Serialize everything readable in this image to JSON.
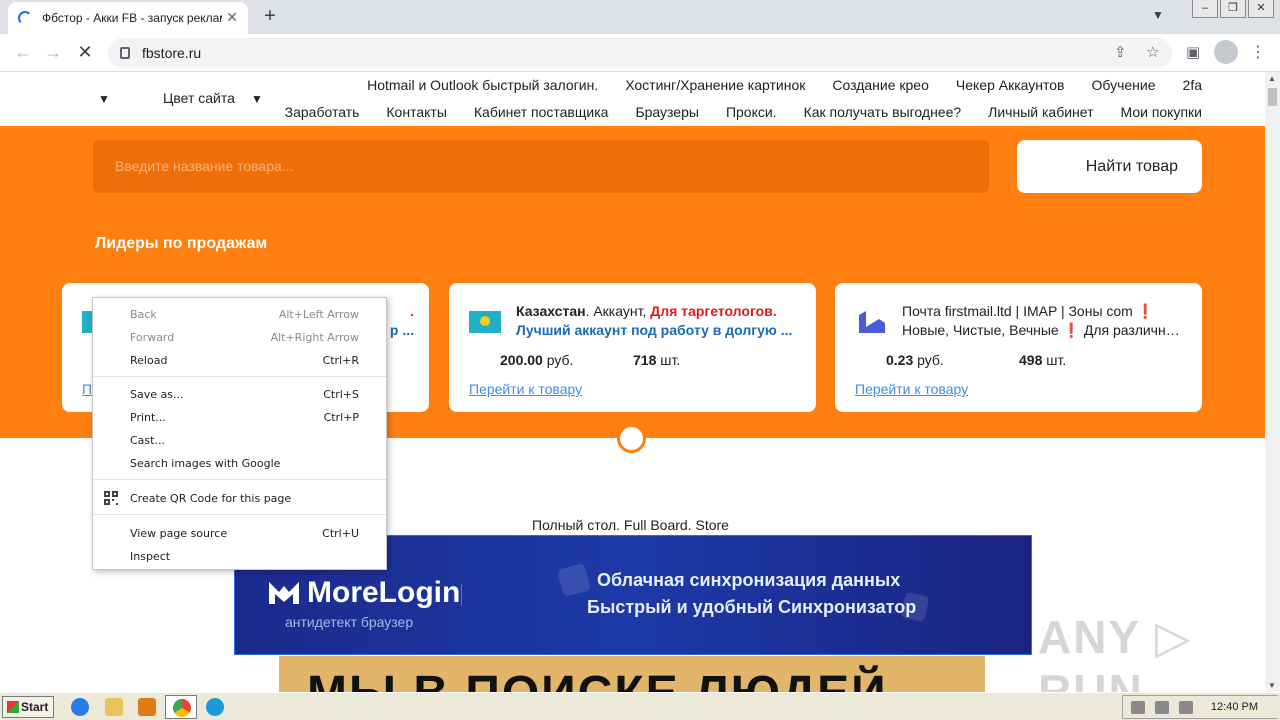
{
  "browser": {
    "tab_title": "Фбстор - Акки FB - запуск реклам",
    "url": "fbstore.ru",
    "window_buttons": [
      "–",
      "❐",
      "✕"
    ]
  },
  "header": {
    "site_color_label": "Цвет сайта",
    "nav_row1": [
      "Hotmail и Outlook быстрый залогин.",
      "Хостинг/Хранение картинок",
      "Создание крео",
      "Чекер Аккаунтов",
      "Обучение",
      "2fa"
    ],
    "nav_row2": [
      "Заработать",
      "Контакты",
      "Кабинет поставщика",
      "Браузеры",
      "Прокси.",
      "Как получать выгоднее?",
      "Личный кабинет",
      "Мои покупки"
    ]
  },
  "search": {
    "placeholder": "Введите название товара...",
    "button_label": "Найти товар"
  },
  "leaders_title": "Лидеры по продажам",
  "cards": [
    {
      "l1_partial": ".",
      "l2_partial": "р ...",
      "link_partial": "П"
    },
    {
      "title_bold": "Казахстан",
      "title_rest": ". Аккаунт, ",
      "title_red": "Для таргетологов.",
      "subtitle": "Лучший аккаунт под работу в долгую ...",
      "price": "200.00",
      "currency": "руб.",
      "stock": "718",
      "stock_unit": "шт.",
      "link": "Перейти к товару"
    },
    {
      "title": "Почта firstmail.ltd | IMAP | Зоны com ❗",
      "subtitle": "Новые, Чистые, Вечные ❗ Для различны...",
      "price": "0.23",
      "currency": "руб.",
      "stock": "498",
      "stock_unit": "шт.",
      "link": "Перейти к товару"
    }
  ],
  "board_label": "Полный стол. Full Board. Store",
  "banner": {
    "brand": "MoreLogin",
    "sub": "антидетект браузер",
    "line1": "Облачная синхронизация данных",
    "line2": "Быстрый и удобный Синхронизатор"
  },
  "banner2_text": "МЫ В ПОИСКЕ ЛЮДЕЙ",
  "watermark": "ANY ▷ RUN",
  "context_menu": {
    "items": [
      {
        "label": "Back",
        "shortcut": "Alt+Left Arrow",
        "disabled": true
      },
      {
        "label": "Forward",
        "shortcut": "Alt+Right Arrow",
        "disabled": true
      },
      {
        "label": "Reload",
        "shortcut": "Ctrl+R",
        "disabled": false
      },
      {
        "label": "Save as...",
        "shortcut": "Ctrl+S",
        "disabled": false
      },
      {
        "label": "Print...",
        "shortcut": "Ctrl+P",
        "disabled": false
      },
      {
        "label": "Cast...",
        "shortcut": "",
        "disabled": false
      },
      {
        "label": "Search images with Google",
        "shortcut": "",
        "disabled": false
      },
      {
        "label": "Create QR Code for this page",
        "shortcut": "",
        "disabled": false
      },
      {
        "label": "View page source",
        "shortcut": "Ctrl+U",
        "disabled": false
      },
      {
        "label": "Inspect",
        "shortcut": "",
        "disabled": false
      }
    ]
  },
  "taskbar": {
    "start_label": "Start",
    "clock": "12:40 PM"
  },
  "colors": {
    "accent_orange": "#ff7f11",
    "link_blue": "#3f8ee0",
    "red": "#e01b1b"
  }
}
